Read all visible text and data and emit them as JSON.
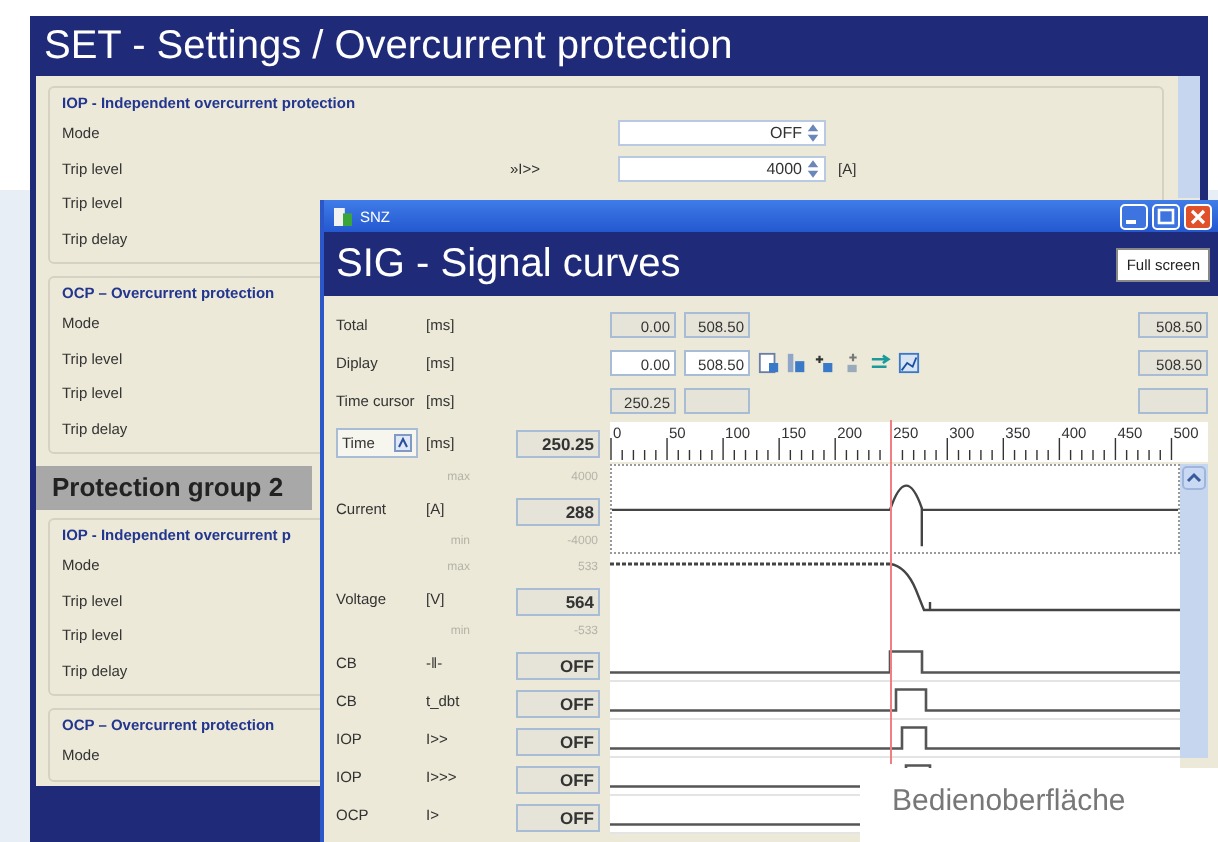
{
  "settings_window": {
    "title": "SET - Settings / Overcurrent protection",
    "sections": [
      {
        "kind": "group",
        "title": "IOP - Independent overcurrent protection",
        "rows": [
          {
            "label": "Mode",
            "value": "OFF"
          },
          {
            "label": "Trip level",
            "symbol": "»I>>",
            "value": "4000",
            "unit": "[A]"
          },
          {
            "label": "Trip level"
          },
          {
            "label": "Trip delay"
          }
        ]
      },
      {
        "kind": "group",
        "title": "OCP – Overcurrent protection",
        "rows": [
          {
            "label": "Mode"
          },
          {
            "label": "Trip level"
          },
          {
            "label": "Trip level"
          },
          {
            "label": "Trip delay"
          }
        ]
      },
      {
        "kind": "heading",
        "title": "Protection group 2"
      },
      {
        "kind": "group",
        "title": "IOP - Independent overcurrent p",
        "rows": [
          {
            "label": "Mode"
          },
          {
            "label": "Trip level"
          },
          {
            "label": "Trip level"
          },
          {
            "label": "Trip delay"
          }
        ]
      },
      {
        "kind": "group",
        "title": "OCP – Overcurrent protection",
        "rows": [
          {
            "label": "Mode"
          }
        ]
      }
    ]
  },
  "signal_window": {
    "app_name": "SNZ",
    "title": "SIG - Signal curves",
    "full_screen_button": "Full screen",
    "time_rows": [
      {
        "label": "Total",
        "unit": "[ms]",
        "from": "0.00",
        "to": "508.50",
        "end": "508.50",
        "editable": false,
        "tools": false
      },
      {
        "label": "Diplay",
        "unit": "[ms]",
        "from": "0.00",
        "to": "508.50",
        "end": "508.50",
        "editable": true,
        "tools": true
      },
      {
        "label": "Time cursor",
        "unit": "[ms]",
        "from": "250.25",
        "editable": false,
        "tools": false
      }
    ],
    "axis": {
      "selector": "Time",
      "unit": "[ms]",
      "value": "250.25",
      "ticks": [
        "0",
        "50",
        "100",
        "150",
        "200",
        "250",
        "300",
        "350",
        "400",
        "450",
        "500"
      ]
    },
    "signals": [
      {
        "kind": "analog",
        "name": "Current",
        "unit": "[A]",
        "value": "288",
        "max_label": "max",
        "max": "4000",
        "min_label": "min",
        "min": "-4000"
      },
      {
        "kind": "analog",
        "name": "Voltage",
        "unit": "[V]",
        "value": "564",
        "max_label": "max",
        "max": "533",
        "min_label": "min",
        "min": "-533"
      },
      {
        "kind": "binary",
        "name": "CB",
        "unit": "-‖-",
        "value": "OFF"
      },
      {
        "kind": "binary",
        "name": "CB",
        "unit": "t_dbt",
        "value": "OFF"
      },
      {
        "kind": "binary",
        "name": "IOP",
        "unit": "I>>",
        "value": "OFF"
      },
      {
        "kind": "binary",
        "name": "IOP",
        "unit": "I>>>",
        "value": "OFF"
      },
      {
        "kind": "binary",
        "name": "OCP",
        "unit": "I>",
        "value": "OFF"
      }
    ]
  },
  "caption": "Bedienoberfläche"
}
